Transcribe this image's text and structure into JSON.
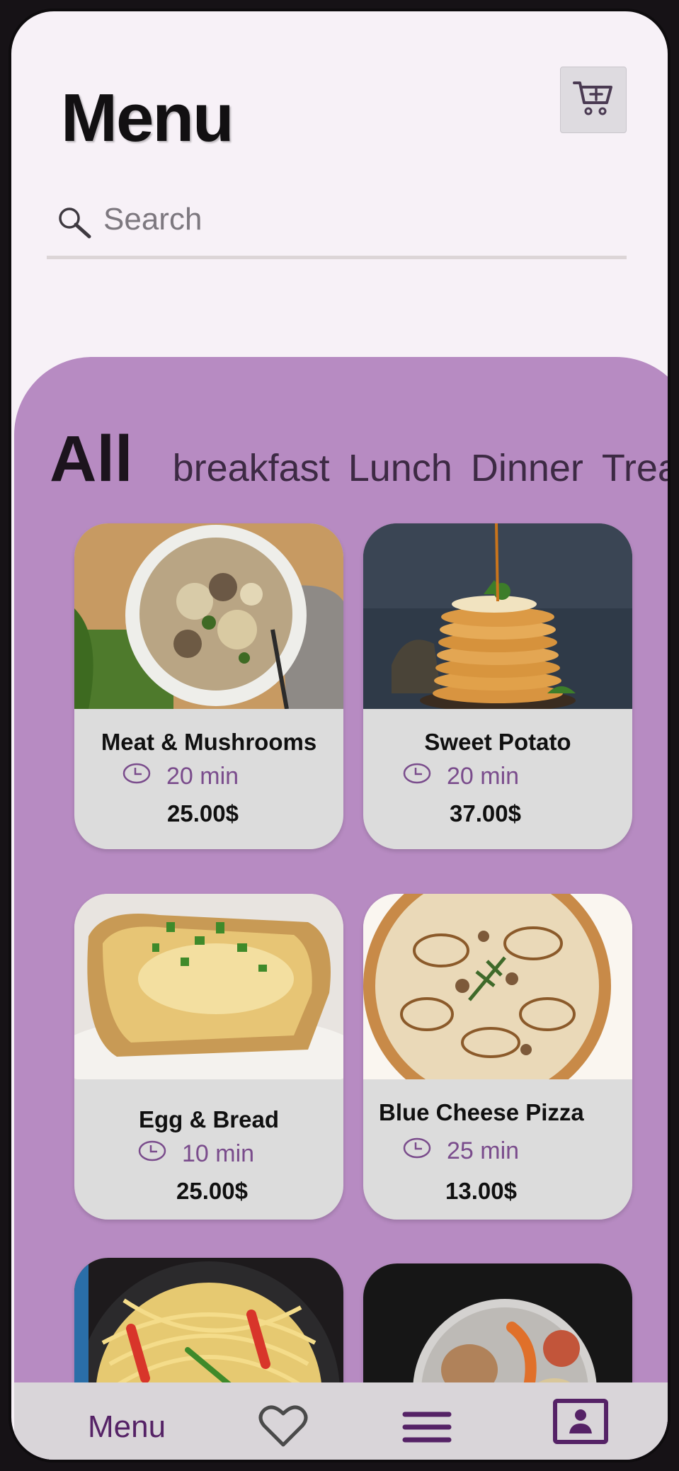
{
  "header": {
    "title": "Menu"
  },
  "search": {
    "placeholder": "Search"
  },
  "tabs": {
    "active": "All",
    "items": [
      "breakfast",
      "Lunch",
      "Dinner",
      "Treats"
    ]
  },
  "cards": [
    {
      "name": "Meat & Mushrooms",
      "time": "20 min",
      "price": "25.00$"
    },
    {
      "name": "Sweet Potato",
      "time": "20 min",
      "price": "37.00$"
    },
    {
      "name": "Egg & Bread",
      "time": "10 min",
      "price": "25.00$"
    },
    {
      "name": "Blue Cheese Pizza",
      "time": "25 min",
      "price": "13.00$"
    }
  ],
  "nav": {
    "menu_label": "Menu"
  },
  "colors": {
    "accent": "#b78bc2",
    "nav_icon": "#552266",
    "time_text": "#7a4c8c"
  },
  "icons": [
    "cart-add-icon",
    "search-icon",
    "clock-icon",
    "heart-icon",
    "hamburger-icon",
    "profile-card-icon"
  ]
}
